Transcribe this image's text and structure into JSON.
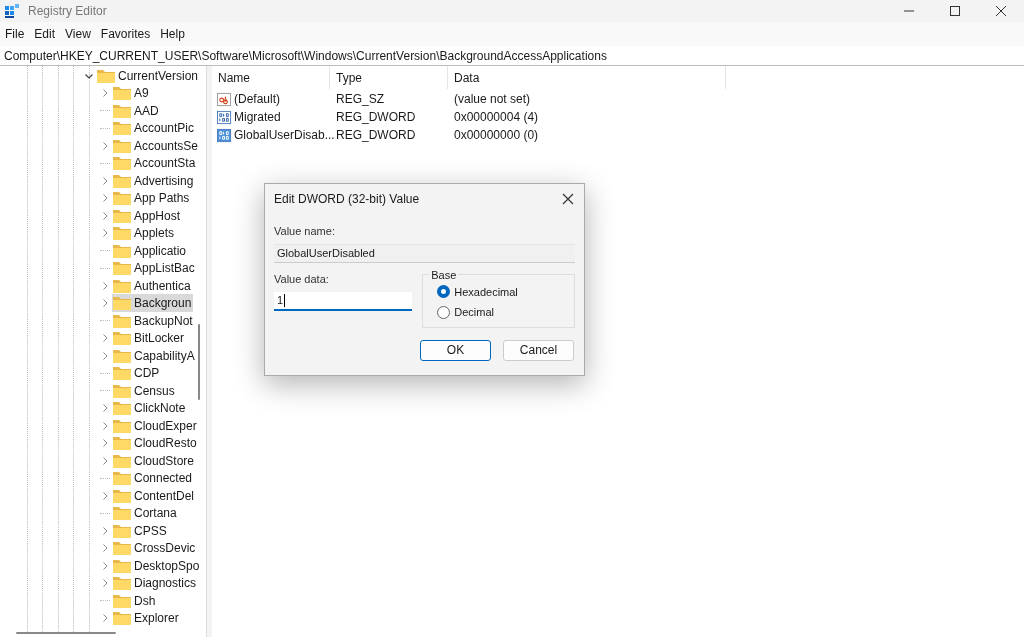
{
  "window": {
    "title": "Registry Editor"
  },
  "menu": [
    "File",
    "Edit",
    "View",
    "Favorites",
    "Help"
  ],
  "address": "Computer\\HKEY_CURRENT_USER\\Software\\Microsoft\\Windows\\CurrentVersion\\BackgroundAccessApplications",
  "tree": {
    "label": "CurrentVersion",
    "expanded": true,
    "selected": false,
    "children": [
      {
        "label": "A9",
        "expandable": true,
        "selected": false
      },
      {
        "label": "AAD",
        "expandable": false,
        "selected": false
      },
      {
        "label": "AccountPic",
        "expandable": false,
        "selected": false
      },
      {
        "label": "AccountsSe",
        "expandable": true,
        "selected": false
      },
      {
        "label": "AccountSta",
        "expandable": false,
        "selected": false
      },
      {
        "label": "Advertising",
        "expandable": true,
        "selected": false
      },
      {
        "label": "App Paths",
        "expandable": true,
        "selected": false
      },
      {
        "label": "AppHost",
        "expandable": true,
        "selected": false
      },
      {
        "label": "Applets",
        "expandable": true,
        "selected": false
      },
      {
        "label": "Applicatio",
        "expandable": false,
        "selected": false
      },
      {
        "label": "AppListBac",
        "expandable": false,
        "selected": false
      },
      {
        "label": "Authentica",
        "expandable": true,
        "selected": false
      },
      {
        "label": "Backgroun",
        "expandable": true,
        "selected": true
      },
      {
        "label": "BackupNot",
        "expandable": false,
        "selected": false
      },
      {
        "label": "BitLocker",
        "expandable": true,
        "selected": false
      },
      {
        "label": "CapabilityA",
        "expandable": true,
        "selected": false
      },
      {
        "label": "CDP",
        "expandable": false,
        "selected": false
      },
      {
        "label": "Census",
        "expandable": false,
        "selected": false
      },
      {
        "label": "ClickNote",
        "expandable": true,
        "selected": false
      },
      {
        "label": "CloudExper",
        "expandable": true,
        "selected": false
      },
      {
        "label": "CloudResto",
        "expandable": true,
        "selected": false
      },
      {
        "label": "CloudStore",
        "expandable": true,
        "selected": false
      },
      {
        "label": "Connected",
        "expandable": false,
        "selected": false
      },
      {
        "label": "ContentDel",
        "expandable": true,
        "selected": false
      },
      {
        "label": "Cortana",
        "expandable": false,
        "selected": false
      },
      {
        "label": "CPSS",
        "expandable": true,
        "selected": false
      },
      {
        "label": "CrossDevic",
        "expandable": true,
        "selected": false
      },
      {
        "label": "DesktopSpo",
        "expandable": true,
        "selected": false
      },
      {
        "label": "Diagnostics",
        "expandable": true,
        "selected": false
      },
      {
        "label": "Dsh",
        "expandable": false,
        "selected": false
      },
      {
        "label": "Explorer",
        "expandable": true,
        "selected": false
      }
    ]
  },
  "values": {
    "columns": [
      "Name",
      "Type",
      "Data"
    ],
    "rows": [
      {
        "kind": "string",
        "name": "(Default)",
        "type": "REG_SZ",
        "data": "(value not set)"
      },
      {
        "kind": "binary",
        "name": "Migrated",
        "type": "REG_DWORD",
        "data": "0x00000004 (4)"
      },
      {
        "kind": "binary_filled",
        "name": "GlobalUserDisab...",
        "type": "REG_DWORD",
        "data": "0x00000000 (0)"
      }
    ]
  },
  "dialog": {
    "title": "Edit DWORD (32-bit) Value",
    "value_name_label": "Value name:",
    "value_name": "GlobalUserDisabled",
    "value_data_label": "Value data:",
    "value_data": "1",
    "base_label": "Base",
    "base_options": [
      {
        "label": "Hexadecimal",
        "selected": true
      },
      {
        "label": "Decimal",
        "selected": false
      }
    ],
    "buttons": [
      {
        "label": "OK",
        "kind": "default"
      },
      {
        "label": "Cancel",
        "kind": "normal"
      }
    ]
  }
}
